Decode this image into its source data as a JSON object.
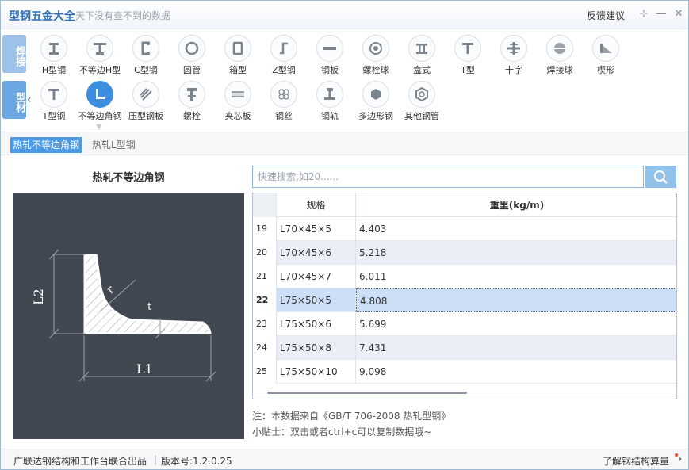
{
  "app": {
    "title": "型钢五金大全",
    "slogan": "天下没有查不到的数据",
    "feedback": "反馈建议",
    "pin_glyph": "⊹",
    "min_glyph": "—",
    "close_glyph": "✕"
  },
  "categories": {
    "weld": "焊接",
    "profile": "型材",
    "arrow": "‹"
  },
  "items_row1": [
    {
      "label": "H型钢",
      "icon": "h-beam-icon"
    },
    {
      "label": "不等边H型",
      "icon": "unequal-h-beam-icon"
    },
    {
      "label": "C型钢",
      "icon": "c-channel-icon"
    },
    {
      "label": "圆管",
      "icon": "round-pipe-icon"
    },
    {
      "label": "箱型",
      "icon": "box-section-icon"
    },
    {
      "label": "Z型钢",
      "icon": "z-section-icon"
    },
    {
      "label": "钢板",
      "icon": "steel-plate-icon"
    },
    {
      "label": "螺栓球",
      "icon": "bolt-ball-icon"
    },
    {
      "label": "盒式",
      "icon": "box-type-icon"
    },
    {
      "label": "T型",
      "icon": "t-section-icon"
    },
    {
      "label": "十字",
      "icon": "cross-section-icon"
    },
    {
      "label": "焊接球",
      "icon": "welded-ball-icon"
    },
    {
      "label": "楔形",
      "icon": "wedge-icon"
    }
  ],
  "items_row2": [
    {
      "label": "T型钢",
      "icon": "t-steel-icon"
    },
    {
      "label": "不等边角钢",
      "icon": "unequal-angle-icon"
    },
    {
      "label": "压型钢板",
      "icon": "profiled-sheet-icon"
    },
    {
      "label": "螺栓",
      "icon": "bolt-icon"
    },
    {
      "label": "夹芯板",
      "icon": "sandwich-panel-icon"
    },
    {
      "label": "钢丝",
      "icon": "steel-wire-icon"
    },
    {
      "label": "钢轨",
      "icon": "rail-icon"
    },
    {
      "label": "多边形钢",
      "icon": "polygon-steel-icon"
    },
    {
      "label": "其他钢管",
      "icon": "other-pipe-icon"
    }
  ],
  "subtabs": {
    "active": "热轧不等边角钢",
    "other": "热轧L型钢"
  },
  "diagram": {
    "title": "热轧不等边角钢",
    "label_l1": "L1",
    "label_l2": "L2",
    "label_r": "r",
    "label_t": "t"
  },
  "search": {
    "placeholder": "快速搜索,如20......",
    "icon": "search-icon"
  },
  "table": {
    "header_spec": "规格",
    "header_weight": "重里(kg/m)",
    "rows": [
      {
        "idx": "19",
        "spec": "L70×45×5",
        "weight": "4.403"
      },
      {
        "idx": "20",
        "spec": "L70×45×6",
        "weight": "5.218"
      },
      {
        "idx": "21",
        "spec": "L70×45×7",
        "weight": "6.011"
      },
      {
        "idx": "22",
        "spec": "L75×50×5",
        "weight": "4.808"
      },
      {
        "idx": "23",
        "spec": "L75×50×6",
        "weight": "5.699"
      },
      {
        "idx": "24",
        "spec": "L75×50×8",
        "weight": "7.431"
      },
      {
        "idx": "25",
        "spec": "L75×50×10",
        "weight": "9.098"
      }
    ]
  },
  "notes": {
    "source": "注：本数据来自《GB/T 706-2008 热轧型钢》",
    "tip": "小贴士：双击或者ctrl+c可以复制数据哦~"
  },
  "status": {
    "producer": "广联达钢结构和工作台联合出品",
    "separator": "|",
    "version": "版本号:1.2.0.25",
    "learn": "了解钢结构算量",
    "arrow": "›"
  },
  "colors": {
    "accent": "#3c8ee0",
    "brand_title": "#2f6fb6",
    "diagram_bg": "#424851",
    "selected_row": "#cddff6"
  }
}
